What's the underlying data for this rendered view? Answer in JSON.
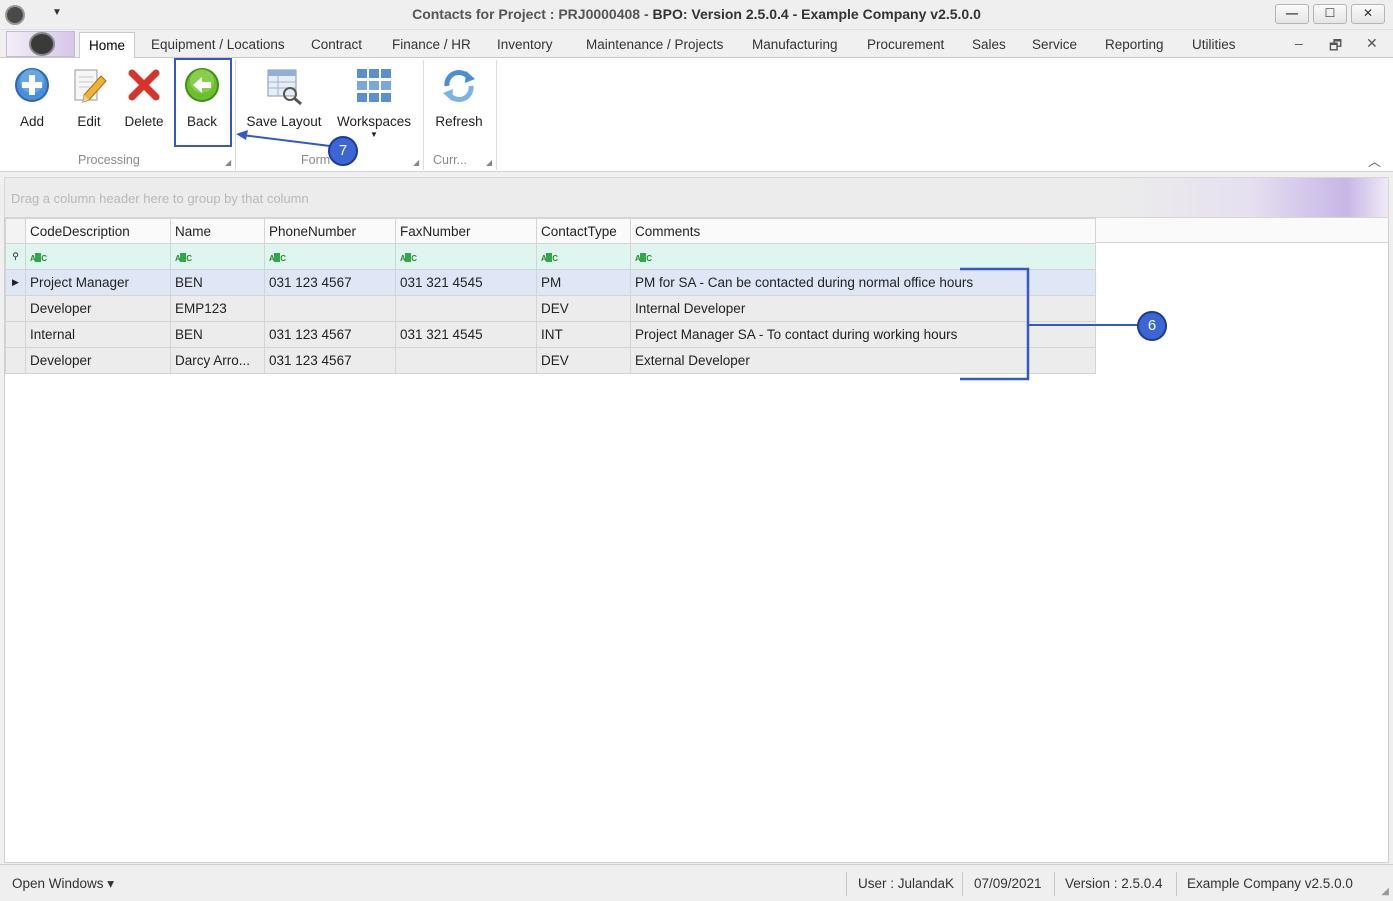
{
  "window": {
    "title_prefix": "Contacts for Project : PRJ0000408 - ",
    "title_main": "BPO: Version 2.5.0.4 - Example Company v2.5.0.0",
    "minimize": "—",
    "maximize": "☐",
    "close": "✕"
  },
  "ribbon_tabs": [
    "Home",
    "Equipment / Locations",
    "Contract",
    "Finance / HR",
    "Inventory",
    "Maintenance / Projects",
    "Manufacturing",
    "Procurement",
    "Sales",
    "Service",
    "Reporting",
    "Utilities"
  ],
  "mdi_controls": {
    "minimize": "–",
    "restore": "🗗",
    "close": "✕"
  },
  "ribbon": {
    "buttons": {
      "add": "Add",
      "edit": "Edit",
      "delete": "Delete",
      "back": "Back",
      "save_layout": "Save Layout",
      "workspaces": "Workspaces",
      "refresh": "Refresh"
    },
    "groups": {
      "processing": "Processing",
      "format": "Form",
      "current": "Curr..."
    },
    "icons": {
      "add": "add-circle-icon",
      "edit": "edit-pencil-icon",
      "delete": "delete-x-icon",
      "back": "back-arrow-icon",
      "save_layout": "save-layout-icon",
      "workspaces": "workspaces-grid-icon",
      "refresh": "refresh-icon"
    }
  },
  "callouts": {
    "back": "7",
    "comments": "6"
  },
  "grid": {
    "group_panel_hint": "Drag a column header here to group by that column",
    "columns": [
      "CodeDescription",
      "Name",
      "PhoneNumber",
      "FaxNumber",
      "ContactType",
      "Comments"
    ],
    "filter_icon": "ABC",
    "rows": [
      [
        "Project Manager",
        "BEN",
        "031 123 4567",
        "031 321 4545",
        "PM",
        "PM for SA - Can be contacted during normal office hours"
      ],
      [
        "Developer",
        "EMP123",
        "",
        "",
        "DEV",
        "Internal Developer"
      ],
      [
        "Internal",
        "BEN",
        "031 123 4567",
        "031 321 4545",
        "INT",
        "Project Manager SA - To contact during working hours"
      ],
      [
        "Developer",
        "Darcy Arro...",
        "031 123 4567",
        "",
        "DEV",
        "External Developer"
      ]
    ]
  },
  "status_bar": {
    "open_windows": "Open Windows ▾",
    "user": "User : JulandaK",
    "date": "07/09/2021",
    "version": "Version : 2.5.0.4",
    "company": "Example Company v2.5.0.0"
  },
  "colors": {
    "accent_blue": "#3558c8",
    "filter_row": "#dff6f0",
    "focused_row": "#dfe7f7"
  }
}
